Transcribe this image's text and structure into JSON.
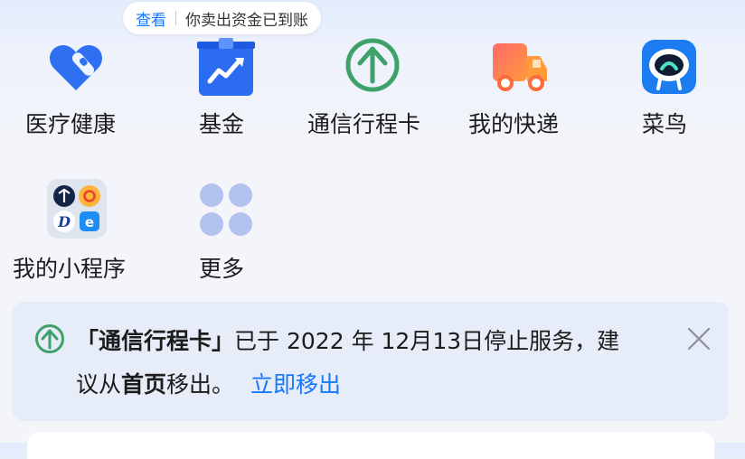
{
  "tooltip": {
    "link": "查看",
    "message": "你卖出资金已到账"
  },
  "apps": [
    {
      "label": "医疗健康",
      "icon": "heart-bandage-icon"
    },
    {
      "label": "基金",
      "icon": "fund-chart-icon"
    },
    {
      "label": "通信行程卡",
      "icon": "green-up-arrow-icon"
    },
    {
      "label": "我的快递",
      "icon": "delivery-truck-icon"
    },
    {
      "label": "菜鸟",
      "icon": "cainiao-robot-icon"
    },
    {
      "label": "我的小程序",
      "icon": "mini-programs-icon"
    },
    {
      "label": "更多",
      "icon": "more-grid-icon"
    }
  ],
  "notice": {
    "quote_open": "「",
    "app_name": "通信行程卡",
    "quote_close": "」",
    "text_main": "已于 2022 年 12月13日停止服务，建",
    "text_line2_a": "议从",
    "text_line2_b": "首页",
    "text_line2_c": "移出。",
    "action": "立即移出"
  },
  "colors": {
    "accent": "#1677ff",
    "green": "#3ea16a"
  }
}
